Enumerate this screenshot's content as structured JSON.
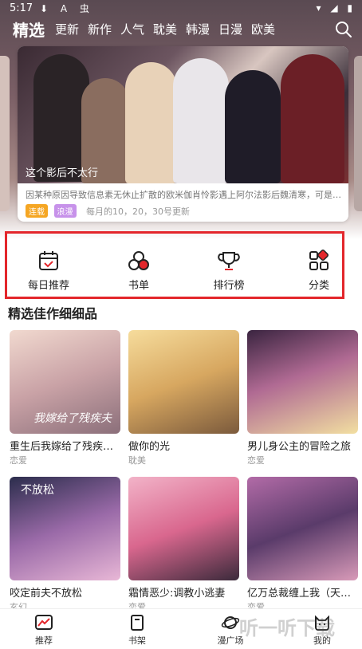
{
  "status_bar": {
    "time": "5:17",
    "left_icons": "⬇ A 虫",
    "right_icons": "▾ ◢ ▮"
  },
  "nav": {
    "tabs": [
      "精选",
      "更新",
      "新作",
      "人气",
      "耽美",
      "韩漫",
      "日漫",
      "欧美"
    ],
    "active_index": 0,
    "search_icon": "search-icon"
  },
  "banner": {
    "caption": "这个影后不太行",
    "description": "因某种原因导致信息素无休止扩散的欧米伽肖怜影遇上阿尔法影后魏清寒，可是…",
    "tags": [
      {
        "label": "连载",
        "color": "#f5a623"
      },
      {
        "label": "浪漫",
        "color": "#c792ea"
      }
    ],
    "schedule": "每月的10，20，30号更新"
  },
  "quick_menu": [
    {
      "label": "每日推荐",
      "icon": "calendar-check-icon"
    },
    {
      "label": "书单",
      "icon": "circles-icon"
    },
    {
      "label": "排行榜",
      "icon": "trophy-icon"
    },
    {
      "label": "分类",
      "icon": "category-grid-icon"
    }
  ],
  "section": {
    "title": "精选佳作细细品"
  },
  "comics": [
    {
      "title": "重生后我嫁给了残疾…",
      "genre": "恋爱",
      "cover_text": "我嫁给了残疾夫"
    },
    {
      "title": "做你的光",
      "genre": "耽美",
      "cover_text": ""
    },
    {
      "title": "男儿身公主的冒险之旅",
      "genre": "恋爱",
      "cover_text": ""
    },
    {
      "title": "咬定前夫不放松",
      "genre": "玄幻",
      "cover_text": "不放松"
    },
    {
      "title": "霜情恶少:调教小逃妻",
      "genre": "恋爱",
      "cover_text": ""
    },
    {
      "title": "亿万总裁缠上我（天…",
      "genre": "恋爱",
      "cover_text": ""
    }
  ],
  "tab_bar": [
    {
      "label": "推荐",
      "icon": "recommend-icon",
      "active": true
    },
    {
      "label": "书架",
      "icon": "bookshelf-icon",
      "active": false
    },
    {
      "label": "漫广场",
      "icon": "planet-icon",
      "active": false
    },
    {
      "label": "我的",
      "icon": "profile-cat-icon",
      "active": false
    }
  ],
  "watermark": "听一听下载"
}
